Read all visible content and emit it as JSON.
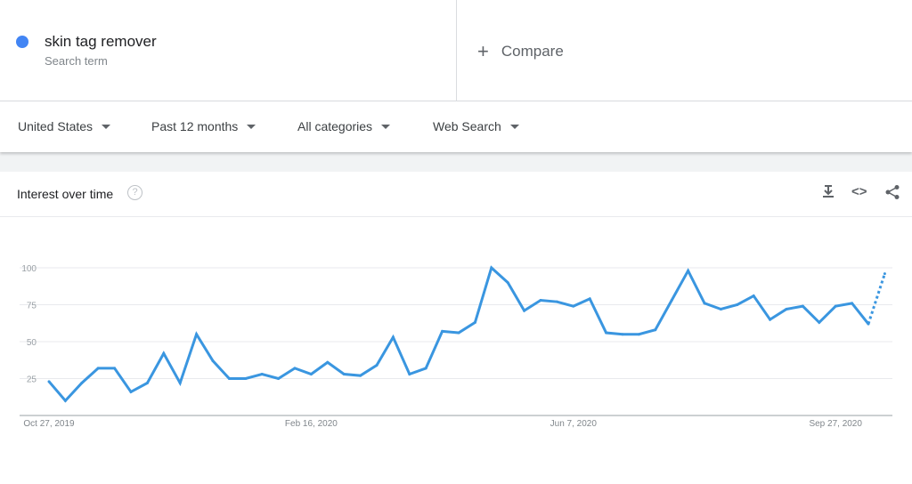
{
  "search_term": {
    "name": "skin tag remover",
    "sublabel": "Search term",
    "color": "#4285f4"
  },
  "compare": {
    "icon": "plus-icon",
    "label": "Compare"
  },
  "filters": {
    "region": "United States",
    "time": "Past 12 months",
    "category": "All categories",
    "property": "Web Search"
  },
  "card": {
    "title": "Interest over time",
    "icons": [
      "help-icon",
      "download-icon",
      "embed-icon",
      "share-icon"
    ]
  },
  "chart_data": {
    "type": "line",
    "color": "#3a96e0",
    "ylim": [
      0,
      100
    ],
    "yticks": [
      "100",
      "75",
      "50",
      "25"
    ],
    "ytick_values": [
      100,
      75,
      50,
      25
    ],
    "xtick_labels": [
      "Oct 27, 2019",
      "Feb 16, 2020",
      "Jun 7, 2020",
      "Sep 27, 2020"
    ],
    "xtick_indices": [
      0,
      16,
      32,
      48
    ],
    "x_start": "2019-10-27",
    "x_interval": "weekly",
    "values": [
      23,
      10,
      22,
      32,
      32,
      16,
      22,
      42,
      22,
      55,
      37,
      25,
      25,
      28,
      25,
      32,
      28,
      36,
      28,
      27,
      34,
      53,
      28,
      32,
      57,
      56,
      63,
      100,
      90,
      71,
      78,
      77,
      74,
      79,
      56,
      55,
      55,
      58,
      78,
      98,
      76,
      72,
      75,
      81,
      65,
      72,
      74,
      63,
      74,
      76,
      62,
      96
    ],
    "partial_last_point": true,
    "grid": true
  }
}
